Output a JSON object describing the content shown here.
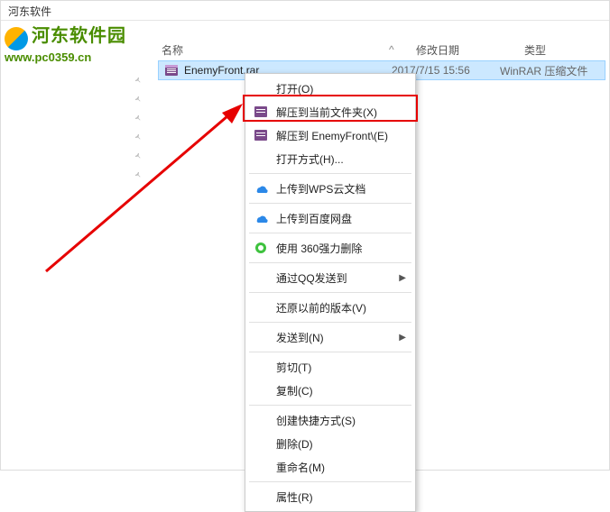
{
  "window": {
    "title": "河东软件"
  },
  "watermark": {
    "brand": "河东软件园",
    "url": "www.pc0359.cn"
  },
  "columns": {
    "name": "名称",
    "sort_glyph": "^",
    "date": "修改日期",
    "type": "类型"
  },
  "file": {
    "name": "EnemyFront.rar",
    "date": "2017/7/15 15:56",
    "type": "WinRAR 压缩文件"
  },
  "menu": {
    "open": "打开(O)",
    "extract_here": "解压到当前文件夹(X)",
    "extract_to": "解压到 EnemyFront\\(E)",
    "open_with": "打开方式(H)...",
    "wps": "上传到WPS云文档",
    "baidu": "上传到百度网盘",
    "360": "使用 360强力删除",
    "qq_send": "通过QQ发送到",
    "restore": "还原以前的版本(V)",
    "send_to": "发送到(N)",
    "cut": "剪切(T)",
    "copy": "复制(C)",
    "shortcut": "创建快捷方式(S)",
    "delete": "删除(D)",
    "rename": "重命名(M)",
    "properties": "属性(R)"
  }
}
